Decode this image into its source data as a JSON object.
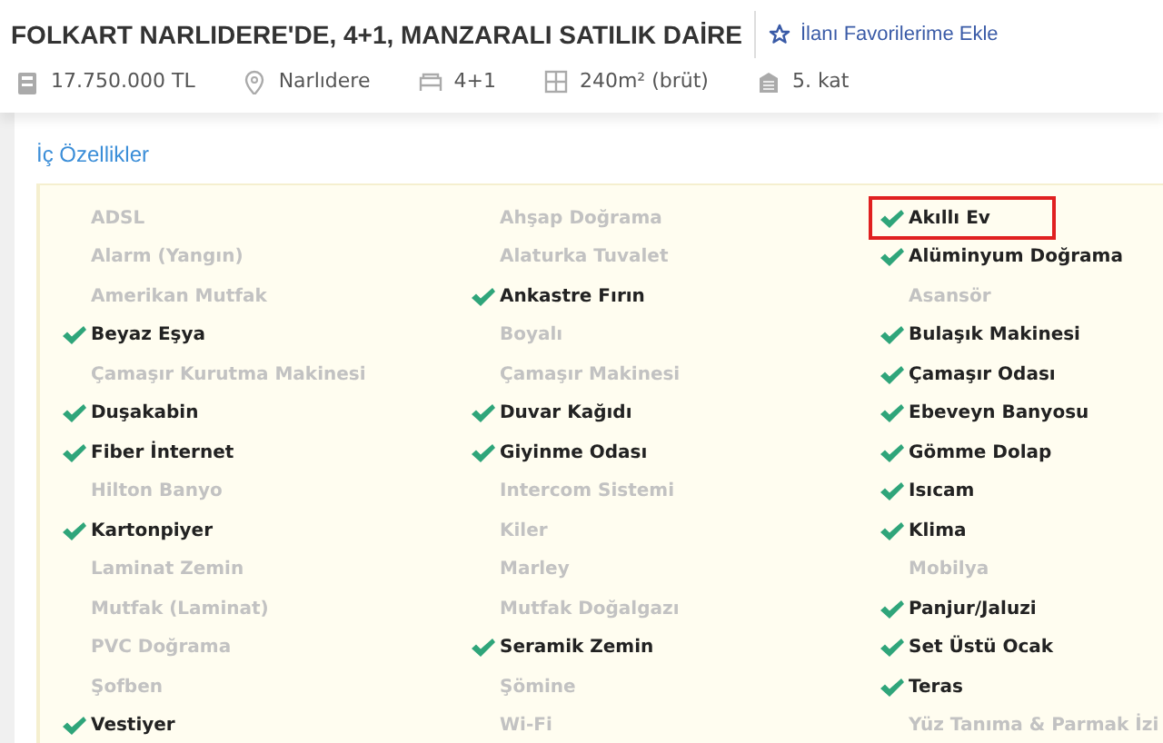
{
  "title": "FOLKART NARLIDERE'DE, 4+1, MANZARALI SATILIK DAİRE",
  "favorite_link": "İlanı Favorilerime Ekle",
  "meta": [
    {
      "kind": "price",
      "text": "17.750.000 TL"
    },
    {
      "kind": "location",
      "text": "Narlıdere"
    },
    {
      "kind": "rooms",
      "text": "4+1"
    },
    {
      "kind": "area",
      "text": "240m² (brüt)"
    },
    {
      "kind": "floor",
      "text": "5. kat"
    }
  ],
  "section_title": "İç Özellikler",
  "features": [
    {
      "label": "ADSL",
      "checked": false
    },
    {
      "label": "Ahşap Doğrama",
      "checked": false
    },
    {
      "label": "Akıllı Ev",
      "checked": true,
      "highlighted": true
    },
    {
      "label": "Alarm (Yangın)",
      "checked": false
    },
    {
      "label": "Alaturka Tuvalet",
      "checked": false
    },
    {
      "label": "Alüminyum Doğrama",
      "checked": true
    },
    {
      "label": "Amerikan Mutfak",
      "checked": false
    },
    {
      "label": "Ankastre Fırın",
      "checked": true
    },
    {
      "label": "Asansör",
      "checked": false
    },
    {
      "label": "Beyaz Eşya",
      "checked": true
    },
    {
      "label": "Boyalı",
      "checked": false
    },
    {
      "label": "Bulaşık Makinesi",
      "checked": true
    },
    {
      "label": "Çamaşır Kurutma Makinesi",
      "checked": false
    },
    {
      "label": "Çamaşır Makinesi",
      "checked": false
    },
    {
      "label": "Çamaşır Odası",
      "checked": true
    },
    {
      "label": "Duşakabin",
      "checked": true
    },
    {
      "label": "Duvar Kağıdı",
      "checked": true
    },
    {
      "label": "Ebeveyn Banyosu",
      "checked": true
    },
    {
      "label": "Fiber İnternet",
      "checked": true
    },
    {
      "label": "Giyinme Odası",
      "checked": true
    },
    {
      "label": "Gömme Dolap",
      "checked": true
    },
    {
      "label": "Hilton Banyo",
      "checked": false
    },
    {
      "label": "Intercom Sistemi",
      "checked": false
    },
    {
      "label": "Isıcam",
      "checked": true
    },
    {
      "label": "Kartonpiyer",
      "checked": true
    },
    {
      "label": "Kiler",
      "checked": false
    },
    {
      "label": "Klima",
      "checked": true
    },
    {
      "label": "Laminat Zemin",
      "checked": false
    },
    {
      "label": "Marley",
      "checked": false
    },
    {
      "label": "Mobilya",
      "checked": false
    },
    {
      "label": "Mutfak (Laminat)",
      "checked": false
    },
    {
      "label": "Mutfak Doğalgazı",
      "checked": false
    },
    {
      "label": "Panjur/Jaluzi",
      "checked": true
    },
    {
      "label": "PVC Doğrama",
      "checked": false
    },
    {
      "label": "Seramik Zemin",
      "checked": true
    },
    {
      "label": "Set Üstü Ocak",
      "checked": true
    },
    {
      "label": "Şofben",
      "checked": false
    },
    {
      "label": "Şömine",
      "checked": false
    },
    {
      "label": "Teras",
      "checked": true
    },
    {
      "label": "Vestiyer",
      "checked": true
    },
    {
      "label": "Wi-Fi",
      "checked": false
    },
    {
      "label": "Yüz Tanıma & Parmak İzi",
      "checked": false
    }
  ]
}
